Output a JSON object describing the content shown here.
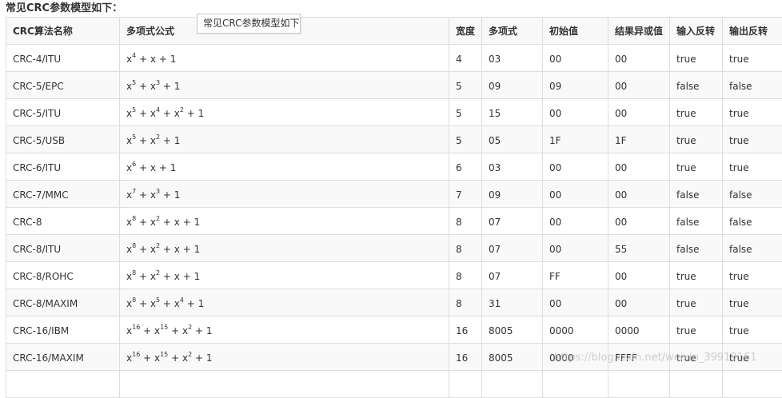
{
  "heading": "常见CRC参数模型如下：",
  "tooltip": "常见CRC参数模型如下",
  "columns": [
    "CRC算法名称",
    "多项式公式",
    "宽度",
    "多项式",
    "初始值",
    "结果异或值",
    "输入反转",
    "输出反转"
  ],
  "rows": [
    {
      "name": "CRC-4/ITU",
      "formula": [
        [
          "x",
          "4"
        ],
        [
          "x",
          ""
        ],
        [
          "1",
          ""
        ]
      ],
      "width": "4",
      "poly": "03",
      "init": "00",
      "xorout": "00",
      "refin": "true",
      "refout": "true"
    },
    {
      "name": "CRC-5/EPC",
      "formula": [
        [
          "x",
          "5"
        ],
        [
          "x",
          "3"
        ],
        [
          "1",
          ""
        ]
      ],
      "width": "5",
      "poly": "09",
      "init": "09",
      "xorout": "00",
      "refin": "false",
      "refout": "false"
    },
    {
      "name": "CRC-5/ITU",
      "formula": [
        [
          "x",
          "5"
        ],
        [
          "x",
          "4"
        ],
        [
          "x",
          "2"
        ],
        [
          "1",
          ""
        ]
      ],
      "width": "5",
      "poly": "15",
      "init": "00",
      "xorout": "00",
      "refin": "true",
      "refout": "true"
    },
    {
      "name": "CRC-5/USB",
      "formula": [
        [
          "x",
          "5"
        ],
        [
          "x",
          "2"
        ],
        [
          "1",
          ""
        ]
      ],
      "width": "5",
      "poly": "05",
      "init": "1F",
      "xorout": "1F",
      "refin": "true",
      "refout": "true"
    },
    {
      "name": "CRC-6/ITU",
      "formula": [
        [
          "x",
          "6"
        ],
        [
          "x",
          ""
        ],
        [
          "1",
          ""
        ]
      ],
      "width": "6",
      "poly": "03",
      "init": "00",
      "xorout": "00",
      "refin": "true",
      "refout": "true"
    },
    {
      "name": "CRC-7/MMC",
      "formula": [
        [
          "x",
          "7"
        ],
        [
          "x",
          "3"
        ],
        [
          "1",
          ""
        ]
      ],
      "width": "7",
      "poly": "09",
      "init": "00",
      "xorout": "00",
      "refin": "false",
      "refout": "false"
    },
    {
      "name": "CRC-8",
      "formula": [
        [
          "x",
          "8"
        ],
        [
          "x",
          "2"
        ],
        [
          "x",
          ""
        ],
        [
          "1",
          ""
        ]
      ],
      "width": "8",
      "poly": "07",
      "init": "00",
      "xorout": "00",
      "refin": "false",
      "refout": "false"
    },
    {
      "name": "CRC-8/ITU",
      "formula": [
        [
          "x",
          "8"
        ],
        [
          "x",
          "2"
        ],
        [
          "x",
          ""
        ],
        [
          "1",
          ""
        ]
      ],
      "width": "8",
      "poly": "07",
      "init": "00",
      "xorout": "55",
      "refin": "false",
      "refout": "false"
    },
    {
      "name": "CRC-8/ROHC",
      "formula": [
        [
          "x",
          "8"
        ],
        [
          "x",
          "2"
        ],
        [
          "x",
          ""
        ],
        [
          "1",
          ""
        ]
      ],
      "width": "8",
      "poly": "07",
      "init": "FF",
      "xorout": "00",
      "refin": "true",
      "refout": "true"
    },
    {
      "name": "CRC-8/MAXIM",
      "formula": [
        [
          "x",
          "8"
        ],
        [
          "x",
          "5"
        ],
        [
          "x",
          "4"
        ],
        [
          "1",
          ""
        ]
      ],
      "width": "8",
      "poly": "31",
      "init": "00",
      "xorout": "00",
      "refin": "true",
      "refout": "true"
    },
    {
      "name": "CRC-16/IBM",
      "formula": [
        [
          "x",
          "16"
        ],
        [
          "x",
          "15"
        ],
        [
          "x",
          "2"
        ],
        [
          "1",
          ""
        ]
      ],
      "width": "16",
      "poly": "8005",
      "init": "0000",
      "xorout": "0000",
      "refin": "true",
      "refout": "true"
    },
    {
      "name": "CRC-16/MAXIM",
      "formula": [
        [
          "x",
          "16"
        ],
        [
          "x",
          "15"
        ],
        [
          "x",
          "2"
        ],
        [
          "1",
          ""
        ]
      ],
      "width": "16",
      "poly": "8005",
      "init": "0000",
      "xorout": "FFFF",
      "refin": "true",
      "refout": "true"
    },
    {
      "name": "",
      "formula": [],
      "width": "",
      "poly": "",
      "init": "",
      "xorout": "",
      "refin": "",
      "refout": ""
    }
  ],
  "watermark": "https://blog.csdn.net/weixin_39919161",
  "colors": {
    "border": "#dddddd",
    "stripe": "#f9f9f9",
    "text": "#333333"
  }
}
